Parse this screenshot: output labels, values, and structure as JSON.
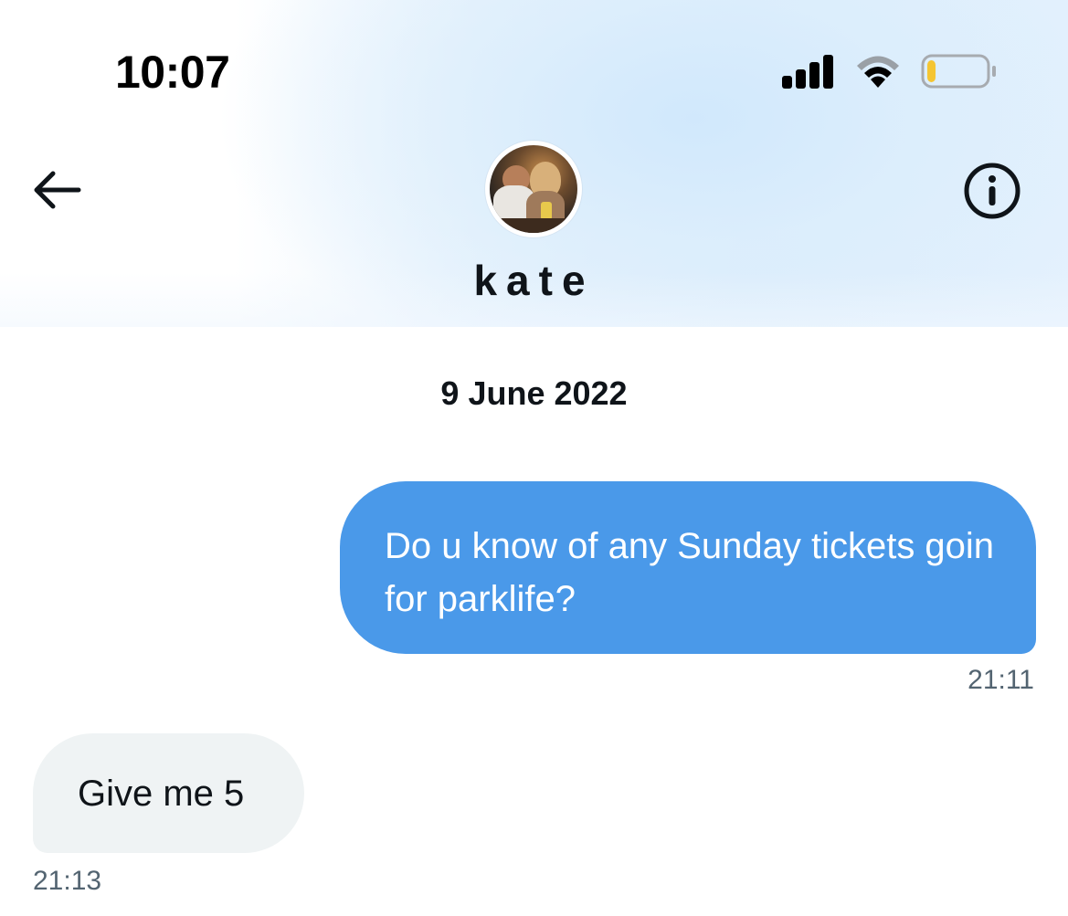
{
  "status_bar": {
    "time": "10:07",
    "signal_bars": 4,
    "battery_level": 0.15,
    "battery_color": "#f5c532"
  },
  "header": {
    "back_icon": "arrow-left-icon",
    "info_icon": "info-circle-icon",
    "contact_name": "kate"
  },
  "conversation": {
    "date_separator": "9 June 2022",
    "messages": [
      {
        "direction": "outgoing",
        "text": "Do u know of any Sunday tickets goin for parklife?",
        "time": "21:11"
      },
      {
        "direction": "incoming",
        "text": "Give me 5",
        "time": "21:13"
      }
    ]
  },
  "colors": {
    "outgoing_bubble": "#4a99e9",
    "incoming_bubble": "#eff3f4",
    "timestamp": "#536471",
    "text_primary": "#0f1419"
  }
}
